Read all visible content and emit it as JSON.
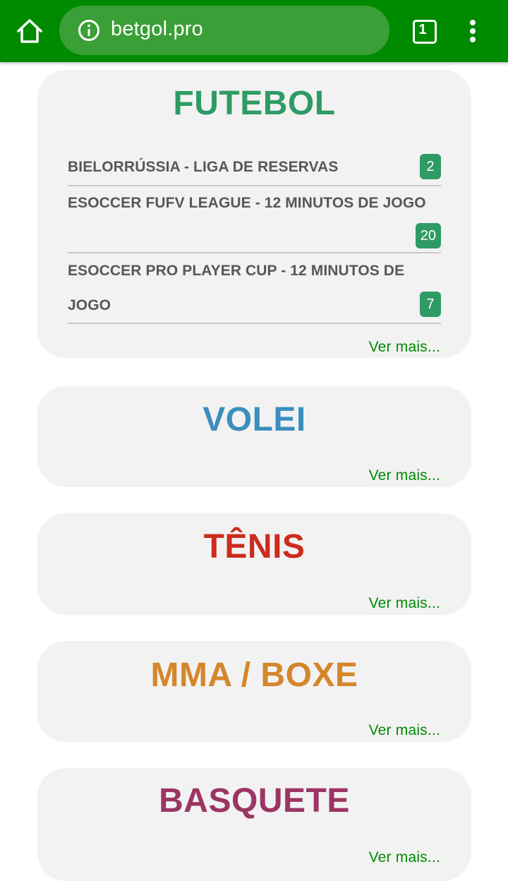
{
  "browser": {
    "url": "betgol.pro",
    "tab_count": "1",
    "toolbar_color": "#008a00"
  },
  "sports": [
    {
      "title": "FUTEBOL",
      "color": "#2f9b64",
      "leagues": [
        {
          "name": "BIELORRÚSSIA - LIGA DE RESERVAS",
          "count": "2"
        },
        {
          "name_line1": "ESOCCER FUFV LEAGUE - 12 MINUTOS DE JOGO",
          "count": "20"
        },
        {
          "name_line1": "ESOCCER PRO PLAYER CUP - 12 MINUTOS DE",
          "name_line2": "JOGO",
          "count": "7"
        }
      ],
      "more": "Ver mais..."
    },
    {
      "title": "VOLEI",
      "color": "#3b8fbf",
      "more": "Ver mais..."
    },
    {
      "title": "TÊNIS",
      "color": "#cc2b1d",
      "more": "Ver mais..."
    },
    {
      "title": "MMA / BOXE",
      "color": "#d5862b",
      "more": "Ver mais..."
    },
    {
      "title": "BASQUETE",
      "color": "#9c3563",
      "more": "Ver mais..."
    }
  ]
}
